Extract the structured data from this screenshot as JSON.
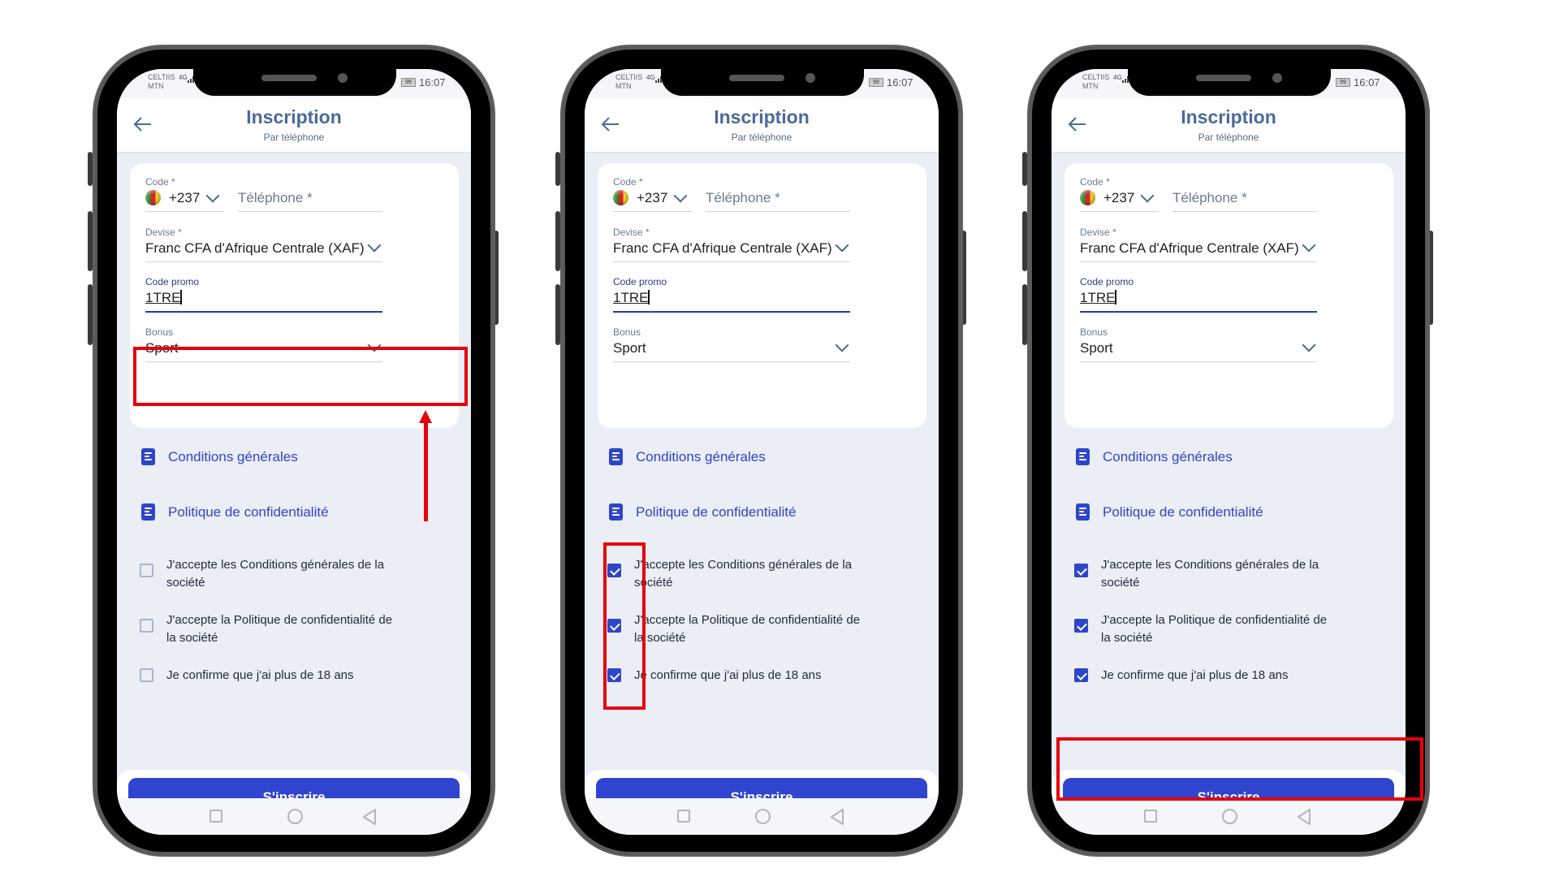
{
  "phones": [
    {
      "status": {
        "carrier_line1": "CELTIIS",
        "carrier_line2": "MTN",
        "network": "4G",
        "battery": "99",
        "time": "16:07"
      },
      "header": {
        "title": "Inscription",
        "subtitle": "Par téléphone"
      },
      "form": {
        "code_label": "Code *",
        "code_value": "+237",
        "phone_placeholder": "Téléphone *",
        "currency_label": "Devise *",
        "currency_value": "Franc CFA d'Afrique Centrale (XAF)",
        "promo_label": "Code promo",
        "promo_value": "1TRE",
        "bonus_label": "Bonus",
        "bonus_value": "Sport"
      },
      "links": [
        {
          "label": "Conditions générales"
        },
        {
          "label": "Politique de confidentialité"
        }
      ],
      "checks": [
        {
          "label": "J'accepte les Conditions générales de la société",
          "checked": false
        },
        {
          "label": "J'accepte la Politique de confidentialité de la société",
          "checked": false
        },
        {
          "label": "Je confirme que j'ai plus de 18 ans",
          "checked": false
        }
      ],
      "submit_label": "S'inscrire",
      "annotation": "bonus-field"
    },
    {
      "status": {
        "carrier_line1": "CELTIIS",
        "carrier_line2": "MTN",
        "network": "4G",
        "battery": "99",
        "time": "16:07"
      },
      "header": {
        "title": "Inscription",
        "subtitle": "Par téléphone"
      },
      "form": {
        "code_label": "Code *",
        "code_value": "+237",
        "phone_placeholder": "Téléphone *",
        "currency_label": "Devise *",
        "currency_value": "Franc CFA d'Afrique Centrale (XAF)",
        "promo_label": "Code promo",
        "promo_value": "1TRE",
        "bonus_label": "Bonus",
        "bonus_value": "Sport"
      },
      "links": [
        {
          "label": "Conditions générales"
        },
        {
          "label": "Politique de confidentialité"
        }
      ],
      "checks": [
        {
          "label": "J'accepte les Conditions générales de la société",
          "checked": true
        },
        {
          "label": "J'accepte la Politique de confidentialité de la société",
          "checked": true
        },
        {
          "label": "Je confirme que j'ai plus de 18 ans",
          "checked": true
        }
      ],
      "submit_label": "S'inscrire",
      "annotation": "checkboxes"
    },
    {
      "status": {
        "carrier_line1": "CELTIIS",
        "carrier_line2": "MTN",
        "network": "4G",
        "battery": "99",
        "time": "16:07"
      },
      "header": {
        "title": "Inscription",
        "subtitle": "Par téléphone"
      },
      "form": {
        "code_label": "Code *",
        "code_value": "+237",
        "phone_placeholder": "Téléphone *",
        "currency_label": "Devise *",
        "currency_value": "Franc CFA d'Afrique Centrale (XAF)",
        "promo_label": "Code promo",
        "promo_value": "1TRE",
        "bonus_label": "Bonus",
        "bonus_value": "Sport"
      },
      "links": [
        {
          "label": "Conditions générales"
        },
        {
          "label": "Politique de confidentialité"
        }
      ],
      "checks": [
        {
          "label": "J'accepte les Conditions générales de la société",
          "checked": true
        },
        {
          "label": "J'accepte la Politique de confidentialité de la société",
          "checked": true
        },
        {
          "label": "Je confirme que j'ai plus de 18 ans",
          "checked": true
        }
      ],
      "submit_label": "S'inscrire",
      "annotation": "submit-button"
    }
  ],
  "colors": {
    "accent": "#2f45cf",
    "annotation": "#e8000b",
    "title": "#4a6a9a",
    "background": "#ebeef5"
  }
}
